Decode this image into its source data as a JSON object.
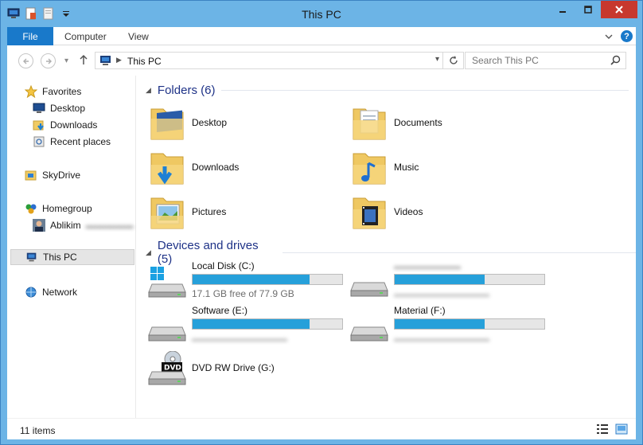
{
  "window": {
    "title": "This PC"
  },
  "ribbon": {
    "tabs": [
      "File",
      "Computer",
      "View"
    ]
  },
  "address": {
    "path": "This PC"
  },
  "search": {
    "placeholder": "Search This PC"
  },
  "sidebar": {
    "items": [
      {
        "label": "Favorites",
        "icon": "star-icon"
      },
      {
        "label": "Desktop",
        "icon": "desktop-icon"
      },
      {
        "label": "Downloads",
        "icon": "downloads-icon"
      },
      {
        "label": "Recent places",
        "icon": "recent-places-icon"
      },
      {
        "label": "SkyDrive",
        "icon": "skydrive-icon"
      },
      {
        "label": "Homegroup",
        "icon": "homegroup-icon"
      },
      {
        "label": "Ablikim",
        "icon": "user-avatar-icon"
      },
      {
        "label": "This PC",
        "icon": "computer-icon"
      },
      {
        "label": "Network",
        "icon": "network-icon"
      }
    ]
  },
  "folders": {
    "heading": "Folders (6)",
    "items": [
      {
        "label": "Desktop",
        "icon": "desktop-folder-icon"
      },
      {
        "label": "Documents",
        "icon": "documents-folder-icon"
      },
      {
        "label": "Downloads",
        "icon": "downloads-folder-icon"
      },
      {
        "label": "Music",
        "icon": "music-folder-icon"
      },
      {
        "label": "Pictures",
        "icon": "pictures-folder-icon"
      },
      {
        "label": "Videos",
        "icon": "videos-folder-icon"
      }
    ]
  },
  "drives": {
    "heading": "Devices and drives (5)",
    "items": [
      {
        "name": "Local Disk (C:)",
        "free": "17.1 GB free of 77.9 GB",
        "used_fraction": 0.78,
        "icon": "windows-drive-icon"
      },
      {
        "name": "",
        "free": "",
        "used_fraction": 0.6,
        "icon": "hard-drive-icon"
      },
      {
        "name": "Software (E:)",
        "free": "",
        "used_fraction": 0.78,
        "icon": "hard-drive-icon"
      },
      {
        "name": "Material (F:)",
        "free": "",
        "used_fraction": 0.6,
        "icon": "hard-drive-icon"
      },
      {
        "name": "DVD RW Drive (G:)",
        "icon": "dvd-drive-icon"
      }
    ]
  },
  "status": {
    "count": "11 items"
  },
  "colors": {
    "accent": "#1979ca",
    "bar_fill": "#26a0da",
    "heading": "#1e3287",
    "close": "#c7382e"
  }
}
